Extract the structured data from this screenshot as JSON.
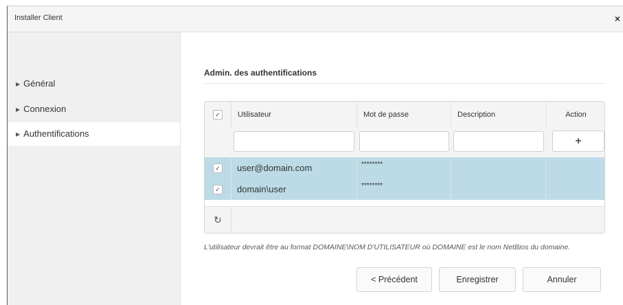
{
  "window": {
    "title": "Installer Client",
    "close_icon": "×"
  },
  "sidebar": {
    "items": [
      {
        "label": "Général"
      },
      {
        "label": "Connexion"
      },
      {
        "label": "Authentifications"
      }
    ]
  },
  "main": {
    "section_title": "Admin. des authentifications",
    "grid": {
      "columns": [
        "Utilisateur",
        "Mot de passe",
        "Description",
        "Action"
      ],
      "header_check": "✓",
      "add_symbol": "+",
      "rows": [
        {
          "checked": "✓",
          "user": "user@domain.com",
          "password": "********",
          "description": ""
        },
        {
          "checked": "✓",
          "user": "domain\\user",
          "password": "********",
          "description": ""
        }
      ],
      "refresh_icon": "↻"
    },
    "hint": "L'utilisateur devrait être au format DOMAINE\\NOM D'UTILISATEUR où DOMAINE est le nom NetBios du domaine.",
    "buttons": {
      "previous": "< Précédent",
      "save": "Enregistrer",
      "cancel": "Annuler"
    }
  },
  "colors": {
    "selected_row": "#bcdbe6",
    "sidebar_bg": "#f0f0f0"
  }
}
